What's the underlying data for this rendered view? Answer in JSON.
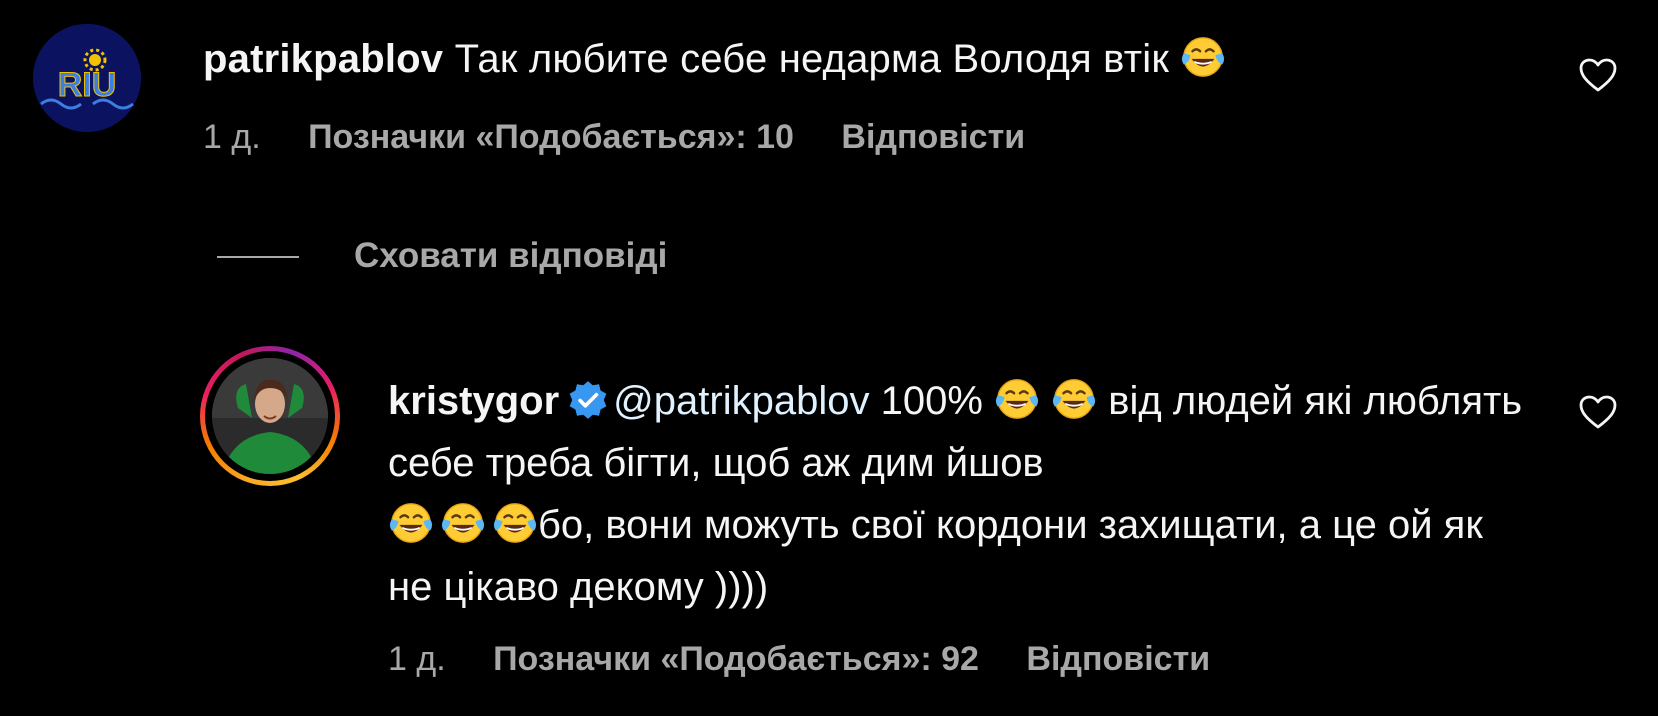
{
  "comment": {
    "username": "patrikpablov",
    "text": "Так любите себе недарма Володя втік",
    "emoji": "face-with-tears-of-joy-icon",
    "avatar_text": "RIU",
    "time": "1 д.",
    "likes": "Позначки «Подобається»: 10",
    "reply": "Відповісти"
  },
  "replies_toggle": {
    "label": "Сховати відповіді"
  },
  "reply": {
    "username": "kristygor",
    "verified": true,
    "mention": "@patrikpablov",
    "text_1": "100%",
    "text_2": "від людей які люблять себе треба бігти, щоб аж дим йшов",
    "text_3": "бо, вони можуть свої кордони захищати, а це ой як не цікаво декому ))))",
    "time": "1 д.",
    "likes": "Позначки «Подобається»: 92",
    "reply": "Відповісти"
  },
  "colors": {
    "background": "#000000",
    "text": "#f5f5f5",
    "secondary": "#a8a8a8",
    "verified": "#3897f0",
    "mention": "#e0f1ff"
  }
}
